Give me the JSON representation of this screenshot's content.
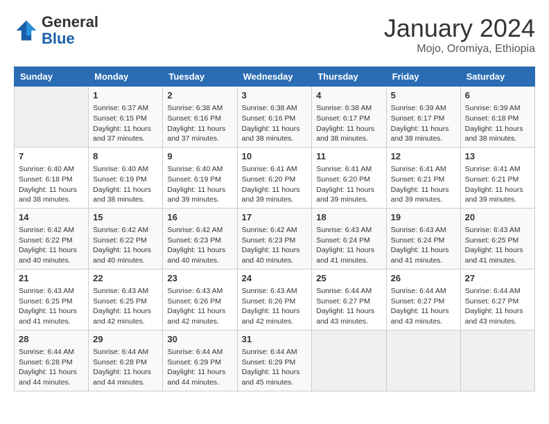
{
  "header": {
    "logo_general": "General",
    "logo_blue": "Blue",
    "month_title": "January 2024",
    "subtitle": "Mojo, Oromiya, Ethiopia"
  },
  "days_of_week": [
    "Sunday",
    "Monday",
    "Tuesday",
    "Wednesday",
    "Thursday",
    "Friday",
    "Saturday"
  ],
  "weeks": [
    [
      {
        "day": "",
        "sunrise": "",
        "sunset": "",
        "daylight": ""
      },
      {
        "day": "1",
        "sunrise": "Sunrise: 6:37 AM",
        "sunset": "Sunset: 6:15 PM",
        "daylight": "Daylight: 11 hours and 37 minutes."
      },
      {
        "day": "2",
        "sunrise": "Sunrise: 6:38 AM",
        "sunset": "Sunset: 6:16 PM",
        "daylight": "Daylight: 11 hours and 37 minutes."
      },
      {
        "day": "3",
        "sunrise": "Sunrise: 6:38 AM",
        "sunset": "Sunset: 6:16 PM",
        "daylight": "Daylight: 11 hours and 38 minutes."
      },
      {
        "day": "4",
        "sunrise": "Sunrise: 6:38 AM",
        "sunset": "Sunset: 6:17 PM",
        "daylight": "Daylight: 11 hours and 38 minutes."
      },
      {
        "day": "5",
        "sunrise": "Sunrise: 6:39 AM",
        "sunset": "Sunset: 6:17 PM",
        "daylight": "Daylight: 11 hours and 38 minutes."
      },
      {
        "day": "6",
        "sunrise": "Sunrise: 6:39 AM",
        "sunset": "Sunset: 6:18 PM",
        "daylight": "Daylight: 11 hours and 38 minutes."
      }
    ],
    [
      {
        "day": "7",
        "sunrise": "Sunrise: 6:40 AM",
        "sunset": "Sunset: 6:18 PM",
        "daylight": "Daylight: 11 hours and 38 minutes."
      },
      {
        "day": "8",
        "sunrise": "Sunrise: 6:40 AM",
        "sunset": "Sunset: 6:19 PM",
        "daylight": "Daylight: 11 hours and 38 minutes."
      },
      {
        "day": "9",
        "sunrise": "Sunrise: 6:40 AM",
        "sunset": "Sunset: 6:19 PM",
        "daylight": "Daylight: 11 hours and 39 minutes."
      },
      {
        "day": "10",
        "sunrise": "Sunrise: 6:41 AM",
        "sunset": "Sunset: 6:20 PM",
        "daylight": "Daylight: 11 hours and 39 minutes."
      },
      {
        "day": "11",
        "sunrise": "Sunrise: 6:41 AM",
        "sunset": "Sunset: 6:20 PM",
        "daylight": "Daylight: 11 hours and 39 minutes."
      },
      {
        "day": "12",
        "sunrise": "Sunrise: 6:41 AM",
        "sunset": "Sunset: 6:21 PM",
        "daylight": "Daylight: 11 hours and 39 minutes."
      },
      {
        "day": "13",
        "sunrise": "Sunrise: 6:41 AM",
        "sunset": "Sunset: 6:21 PM",
        "daylight": "Daylight: 11 hours and 39 minutes."
      }
    ],
    [
      {
        "day": "14",
        "sunrise": "Sunrise: 6:42 AM",
        "sunset": "Sunset: 6:22 PM",
        "daylight": "Daylight: 11 hours and 40 minutes."
      },
      {
        "day": "15",
        "sunrise": "Sunrise: 6:42 AM",
        "sunset": "Sunset: 6:22 PM",
        "daylight": "Daylight: 11 hours and 40 minutes."
      },
      {
        "day": "16",
        "sunrise": "Sunrise: 6:42 AM",
        "sunset": "Sunset: 6:23 PM",
        "daylight": "Daylight: 11 hours and 40 minutes."
      },
      {
        "day": "17",
        "sunrise": "Sunrise: 6:42 AM",
        "sunset": "Sunset: 6:23 PM",
        "daylight": "Daylight: 11 hours and 40 minutes."
      },
      {
        "day": "18",
        "sunrise": "Sunrise: 6:43 AM",
        "sunset": "Sunset: 6:24 PM",
        "daylight": "Daylight: 11 hours and 41 minutes."
      },
      {
        "day": "19",
        "sunrise": "Sunrise: 6:43 AM",
        "sunset": "Sunset: 6:24 PM",
        "daylight": "Daylight: 11 hours and 41 minutes."
      },
      {
        "day": "20",
        "sunrise": "Sunrise: 6:43 AM",
        "sunset": "Sunset: 6:25 PM",
        "daylight": "Daylight: 11 hours and 41 minutes."
      }
    ],
    [
      {
        "day": "21",
        "sunrise": "Sunrise: 6:43 AM",
        "sunset": "Sunset: 6:25 PM",
        "daylight": "Daylight: 11 hours and 41 minutes."
      },
      {
        "day": "22",
        "sunrise": "Sunrise: 6:43 AM",
        "sunset": "Sunset: 6:25 PM",
        "daylight": "Daylight: 11 hours and 42 minutes."
      },
      {
        "day": "23",
        "sunrise": "Sunrise: 6:43 AM",
        "sunset": "Sunset: 6:26 PM",
        "daylight": "Daylight: 11 hours and 42 minutes."
      },
      {
        "day": "24",
        "sunrise": "Sunrise: 6:43 AM",
        "sunset": "Sunset: 6:26 PM",
        "daylight": "Daylight: 11 hours and 42 minutes."
      },
      {
        "day": "25",
        "sunrise": "Sunrise: 6:44 AM",
        "sunset": "Sunset: 6:27 PM",
        "daylight": "Daylight: 11 hours and 43 minutes."
      },
      {
        "day": "26",
        "sunrise": "Sunrise: 6:44 AM",
        "sunset": "Sunset: 6:27 PM",
        "daylight": "Daylight: 11 hours and 43 minutes."
      },
      {
        "day": "27",
        "sunrise": "Sunrise: 6:44 AM",
        "sunset": "Sunset: 6:27 PM",
        "daylight": "Daylight: 11 hours and 43 minutes."
      }
    ],
    [
      {
        "day": "28",
        "sunrise": "Sunrise: 6:44 AM",
        "sunset": "Sunset: 6:28 PM",
        "daylight": "Daylight: 11 hours and 44 minutes."
      },
      {
        "day": "29",
        "sunrise": "Sunrise: 6:44 AM",
        "sunset": "Sunset: 6:28 PM",
        "daylight": "Daylight: 11 hours and 44 minutes."
      },
      {
        "day": "30",
        "sunrise": "Sunrise: 6:44 AM",
        "sunset": "Sunset: 6:29 PM",
        "daylight": "Daylight: 11 hours and 44 minutes."
      },
      {
        "day": "31",
        "sunrise": "Sunrise: 6:44 AM",
        "sunset": "Sunset: 6:29 PM",
        "daylight": "Daylight: 11 hours and 45 minutes."
      },
      {
        "day": "",
        "sunrise": "",
        "sunset": "",
        "daylight": ""
      },
      {
        "day": "",
        "sunrise": "",
        "sunset": "",
        "daylight": ""
      },
      {
        "day": "",
        "sunrise": "",
        "sunset": "",
        "daylight": ""
      }
    ]
  ]
}
